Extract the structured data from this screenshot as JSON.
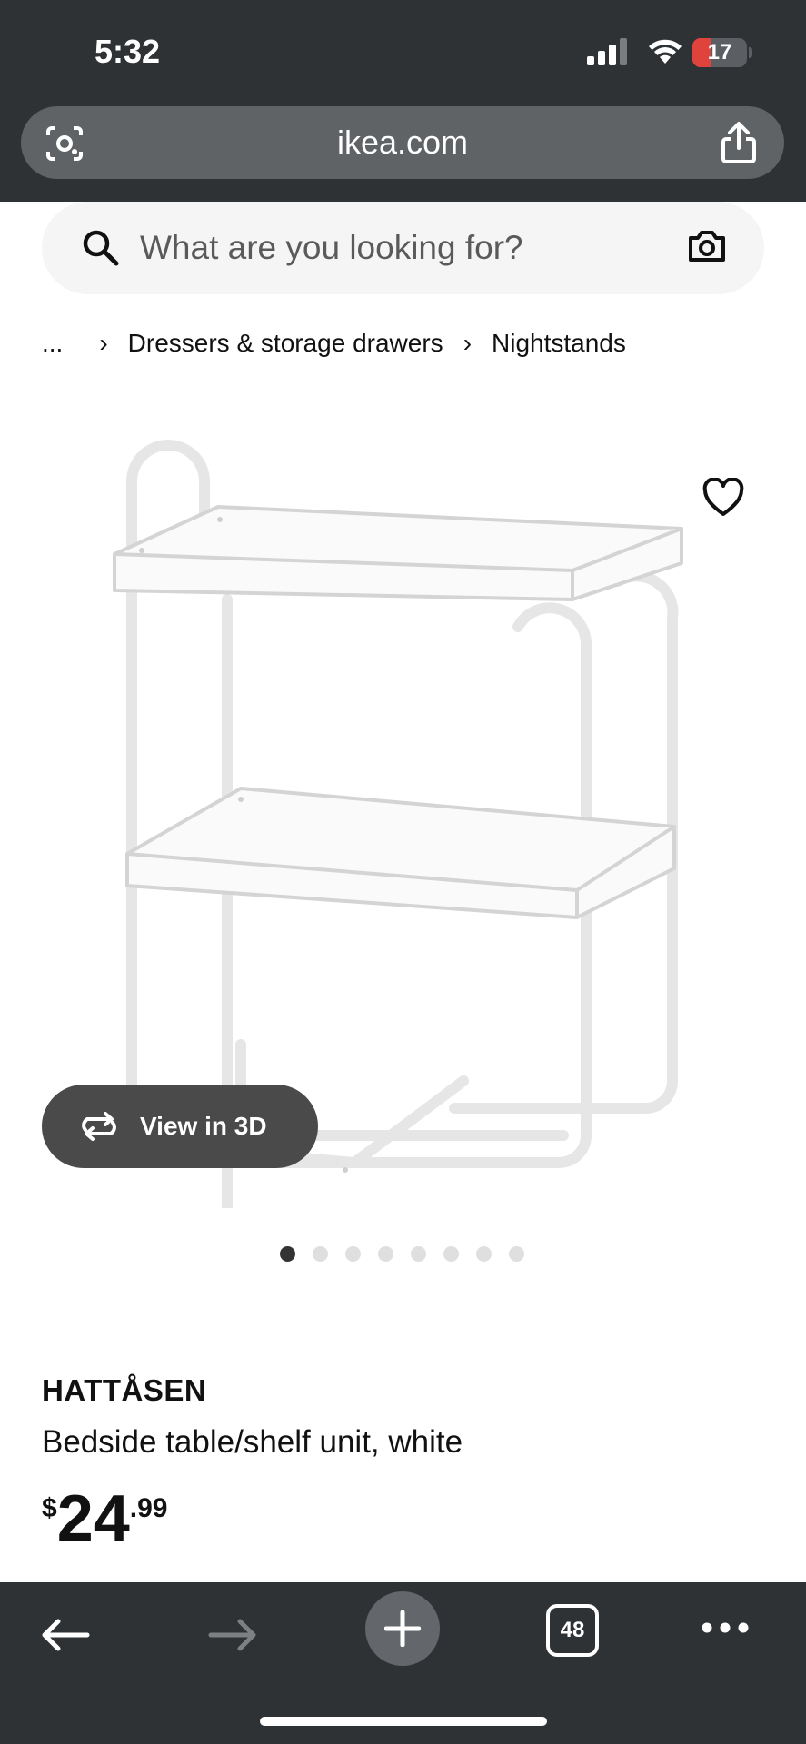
{
  "status": {
    "time": "5:32",
    "battery": "17"
  },
  "browser": {
    "url": "ikea.com",
    "tabs_count": "48"
  },
  "search": {
    "placeholder": "What are you looking for?"
  },
  "breadcrumb": {
    "ellipsis": "...",
    "items": [
      "Dressers & storage drawers",
      "Nightstands"
    ]
  },
  "product": {
    "name": "HATTÅSEN",
    "description": "Bedside table/shelf unit, white",
    "price_currency": "$",
    "price_int": "24",
    "price_dec": ".99",
    "view3d_label": "View in 3D",
    "image_count": 8,
    "active_image": 1
  },
  "colors": {
    "chrome": "#2f3235",
    "url_bar": "#5f6366",
    "search_bg": "#f5f5f5",
    "battery_low": "#e0433b"
  },
  "icons": [
    "lens-icon",
    "share-icon",
    "search-icon",
    "camera-icon",
    "heart-icon",
    "rotate-3d-icon",
    "back-arrow-icon",
    "forward-arrow-icon",
    "plus-icon",
    "more-icon"
  ]
}
